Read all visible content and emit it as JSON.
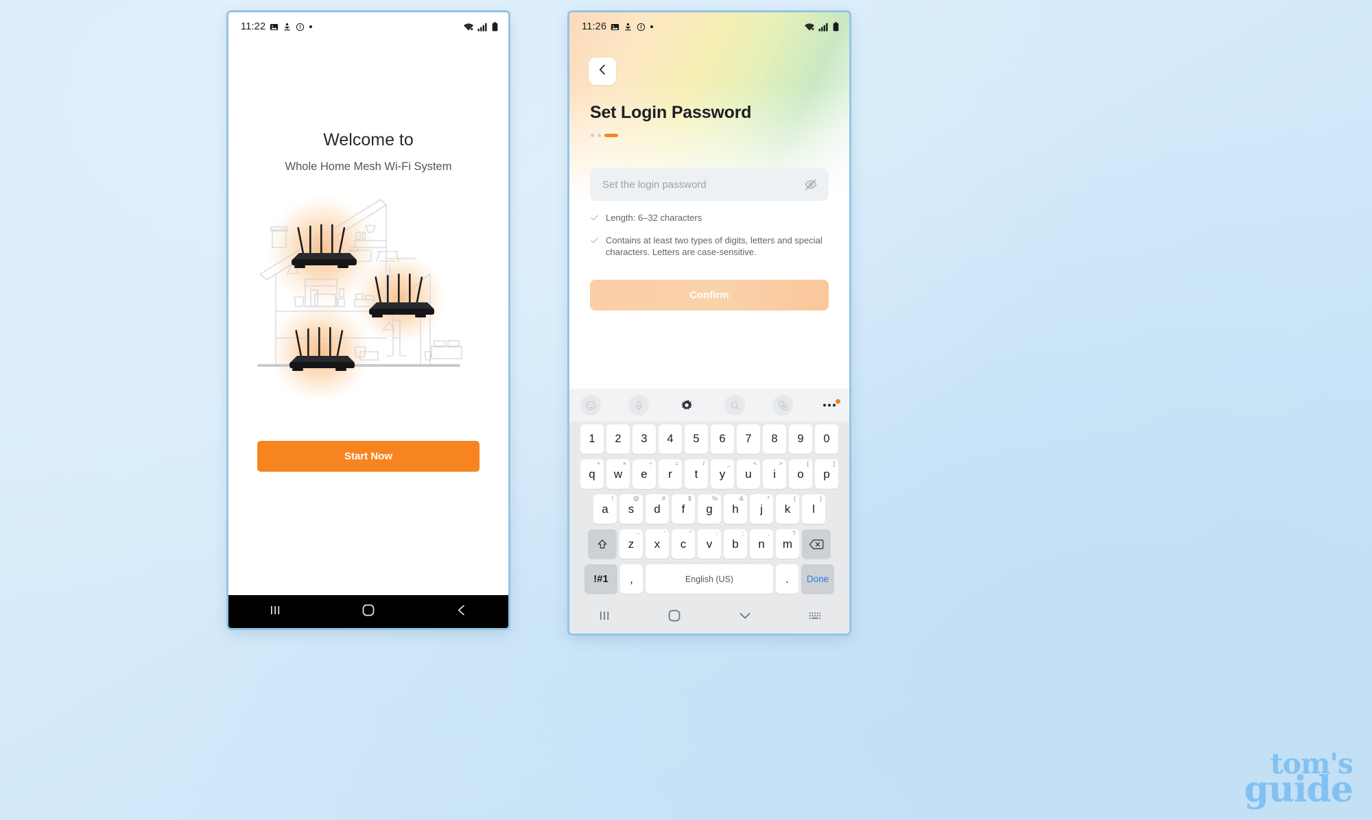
{
  "watermark": {
    "line1": "tom's",
    "line2": "guide",
    "color": "#7fc0f2"
  },
  "accent": {
    "orange": "#f7841f",
    "orange_faded": "#fbcfa6",
    "blue_link": "#2b7ce0"
  },
  "left_phone": {
    "status": {
      "time": "11:22",
      "icons_left": [
        "image-icon",
        "download-icon",
        "alert-circle-icon",
        "dot-icon"
      ],
      "icons_right": [
        "wifi-icon",
        "signal-icon",
        "battery-icon"
      ]
    },
    "welcome_title": "Welcome to",
    "welcome_subtitle": "Whole Home Mesh Wi-Fi System",
    "illustration": "mesh-home-routers-illustration",
    "start_button": "Start Now",
    "nav": [
      "recents-icon",
      "home-icon",
      "back-icon"
    ]
  },
  "right_phone": {
    "status": {
      "time": "11:26",
      "icons_left": [
        "image-icon",
        "download-icon",
        "alert-circle-icon",
        "dot-icon"
      ],
      "icons_right": [
        "wifi-icon",
        "signal-icon",
        "battery-icon"
      ]
    },
    "back_button": "back-chevron-icon",
    "title": "Set Login Password",
    "steps": {
      "total": 3,
      "current": 3
    },
    "password_field": {
      "value": "",
      "placeholder": "Set the login password",
      "toggle": "eye-off-icon"
    },
    "requirements": [
      "Length: 6–32 characters",
      "Contains at least two types of digits, letters and special characters. Letters are case-sensitive."
    ],
    "confirm_button": "Confirm",
    "keyboard": {
      "toolbar": [
        "emoji-icon",
        "microphone-icon",
        "settings-gear-icon",
        "search-icon",
        "translate-icon",
        "more-options-icon"
      ],
      "number_row": [
        "1",
        "2",
        "3",
        "4",
        "5",
        "6",
        "7",
        "8",
        "9",
        "0"
      ],
      "row1": [
        {
          "k": "q",
          "s": "+"
        },
        {
          "k": "w",
          "s": "×"
        },
        {
          "k": "e",
          "s": "÷"
        },
        {
          "k": "r",
          "s": "="
        },
        {
          "k": "t",
          "s": "/"
        },
        {
          "k": "y",
          "s": "_"
        },
        {
          "k": "u",
          "s": "<"
        },
        {
          "k": "i",
          "s": ">"
        },
        {
          "k": "o",
          "s": "["
        },
        {
          "k": "p",
          "s": "]"
        }
      ],
      "row2": [
        {
          "k": "a",
          "s": "!"
        },
        {
          "k": "s",
          "s": "@"
        },
        {
          "k": "d",
          "s": "#"
        },
        {
          "k": "f",
          "s": "$"
        },
        {
          "k": "g",
          "s": "%"
        },
        {
          "k": "h",
          "s": "&"
        },
        {
          "k": "j",
          "s": "*"
        },
        {
          "k": "k",
          "s": "("
        },
        {
          "k": "l",
          "s": ")"
        }
      ],
      "row3": [
        {
          "k": "z",
          "s": "-"
        },
        {
          "k": "x",
          "s": "'"
        },
        {
          "k": "c",
          "s": "\""
        },
        {
          "k": "v",
          "s": ":"
        },
        {
          "k": "b",
          "s": ";"
        },
        {
          "k": "n",
          "s": ","
        },
        {
          "k": "m",
          "s": "?"
        }
      ],
      "shift": "shift-icon",
      "backspace": "backspace-icon",
      "symbols_key": "!#1",
      "comma_key": ",",
      "space_key": "English (US)",
      "period_key": ".",
      "done_key": "Done"
    },
    "nav": [
      "recents-icon",
      "home-icon",
      "hide-keyboard-icon",
      "keyboard-switch-icon"
    ]
  }
}
